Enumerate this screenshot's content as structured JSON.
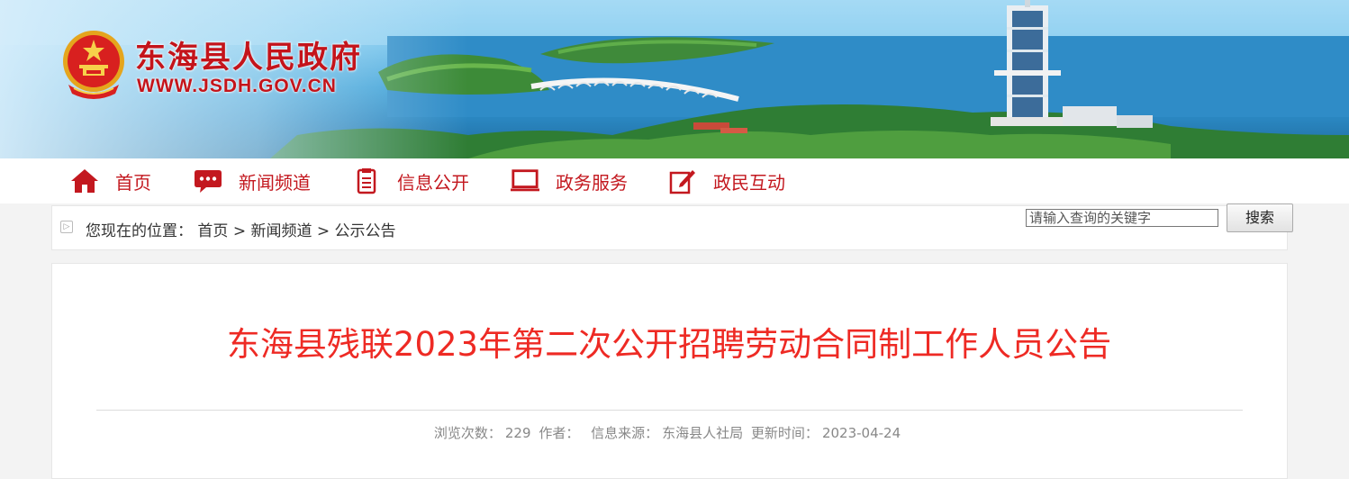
{
  "site": {
    "name": "东海县人民政府",
    "url": "WWW.JSDH.GOV.CN"
  },
  "nav": {
    "items": [
      {
        "label": "首页",
        "icon": "home-icon"
      },
      {
        "label": "新闻频道",
        "icon": "chat-bubble-icon"
      },
      {
        "label": "信息公开",
        "icon": "document-icon"
      },
      {
        "label": "政务服务",
        "icon": "monitor-icon"
      },
      {
        "label": "政民互动",
        "icon": "edit-icon"
      }
    ]
  },
  "breadcrumb": {
    "prefix": "您现在的位置：",
    "items": [
      "首页",
      "新闻频道",
      "公示公告"
    ],
    "separator": ">"
  },
  "search": {
    "placeholder": "请输入查询的关键字",
    "button_label": "搜索"
  },
  "article": {
    "title": "东海县残联2023年第二次公开招聘劳动合同制工作人员公告",
    "views_label": "浏览次数：",
    "views": "229",
    "author_label": "作者：",
    "author": "",
    "source_label": "信息来源：",
    "source": "东海县人社局",
    "updated_label": "更新时间：",
    "updated": "2023-04-24"
  },
  "colors": {
    "brand_red": "#c3181f",
    "title_red": "#ee2a24"
  }
}
